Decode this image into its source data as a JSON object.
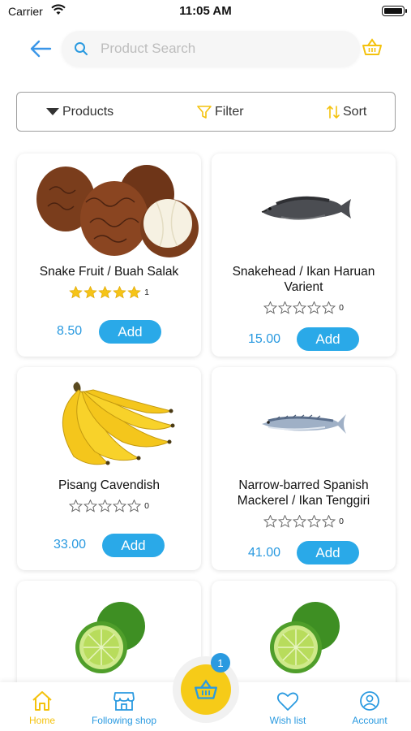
{
  "status_bar": {
    "carrier": "Carrier",
    "time": "11:05 AM"
  },
  "search": {
    "placeholder": "Product Search"
  },
  "filter_bar": {
    "products_label": "Products",
    "filter_label": "Filter",
    "sort_label": "Sort"
  },
  "products": [
    {
      "name": "Snake Fruit / Buah Salak",
      "rating": 5,
      "rating_count": "1",
      "price": "8.50",
      "add_label": "Add",
      "image_icon": "snake-fruit-image"
    },
    {
      "name": "Snakehead / Ikan Haruan Varient",
      "rating": 0,
      "rating_count": "0",
      "price": "15.00",
      "add_label": "Add",
      "image_icon": "snakehead-fish-image"
    },
    {
      "name": "Pisang Cavendish",
      "rating": 0,
      "rating_count": "0",
      "price": "33.00",
      "add_label": "Add",
      "image_icon": "banana-image"
    },
    {
      "name": "Narrow-barred Spanish Mackerel / Ikan Tenggiri",
      "rating": 0,
      "rating_count": "0",
      "price": "41.00",
      "add_label": "Add",
      "image_icon": "mackerel-fish-image"
    },
    {
      "name": "",
      "image_icon": "lime-image"
    },
    {
      "name": "",
      "image_icon": "lime-image"
    }
  ],
  "bottom_nav": {
    "home": "Home",
    "following_shop": "Following shop",
    "cart_badge": "1",
    "wish_list": "Wish list",
    "account": "Account"
  },
  "colors": {
    "accent": "#2aa9e8",
    "price": "#2a9ae0",
    "cart": "#f6cb18",
    "star": "#f6c417"
  }
}
